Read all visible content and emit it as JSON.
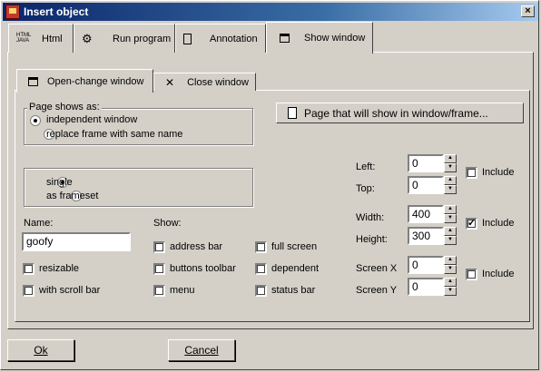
{
  "window": {
    "title": "Insert object",
    "close_label": "×"
  },
  "tabs": [
    {
      "label": "Html",
      "icon": "html-java-icon"
    },
    {
      "label": "Run program",
      "icon": "gears-icon"
    },
    {
      "label": "Annotation",
      "icon": "notepad-icon"
    },
    {
      "label": "Show window",
      "icon": "window-icon",
      "active": true
    }
  ],
  "inner_tabs": [
    {
      "label": "Open-change window",
      "icon": "window-icon",
      "active": true
    },
    {
      "label": "Close window",
      "icon": "close-window-icon"
    }
  ],
  "page_shows_as": {
    "legend": "Page shows as:",
    "options": [
      "independent window",
      "replace frame with same name"
    ],
    "selected": 0
  },
  "page_button": {
    "label": "Page that will show in window/frame..."
  },
  "mode": {
    "options": [
      "single",
      "as frameset"
    ],
    "selected": 0
  },
  "name": {
    "label": "Name:",
    "value": "goofy"
  },
  "left_checks": [
    {
      "label": "resizable",
      "checked": false
    },
    {
      "label": "with scroll bar",
      "checked": false
    }
  ],
  "show": {
    "label": "Show:",
    "col1": [
      {
        "label": "address bar",
        "checked": false
      },
      {
        "label": "buttons toolbar",
        "checked": false
      },
      {
        "label": "menu",
        "checked": false
      }
    ],
    "col2": [
      {
        "label": "full screen",
        "checked": false
      },
      {
        "label": "dependent",
        "checked": false
      },
      {
        "label": "status bar",
        "checked": false
      }
    ]
  },
  "position": {
    "left": {
      "label": "Left:",
      "value": "0"
    },
    "top": {
      "label": "Top:",
      "value": "0"
    },
    "include_label": "Include",
    "include": false
  },
  "size": {
    "width": {
      "label": "Width:",
      "value": "400"
    },
    "height": {
      "label": "Height:",
      "value": "300"
    },
    "include_label": "Include",
    "include": true
  },
  "screen": {
    "x": {
      "label": "Screen X",
      "value": "0"
    },
    "y": {
      "label": "Screen Y",
      "value": "0"
    },
    "include_label": "Include",
    "include": false
  },
  "footer": {
    "ok_label": "Ok",
    "cancel_label": "Cancel"
  }
}
